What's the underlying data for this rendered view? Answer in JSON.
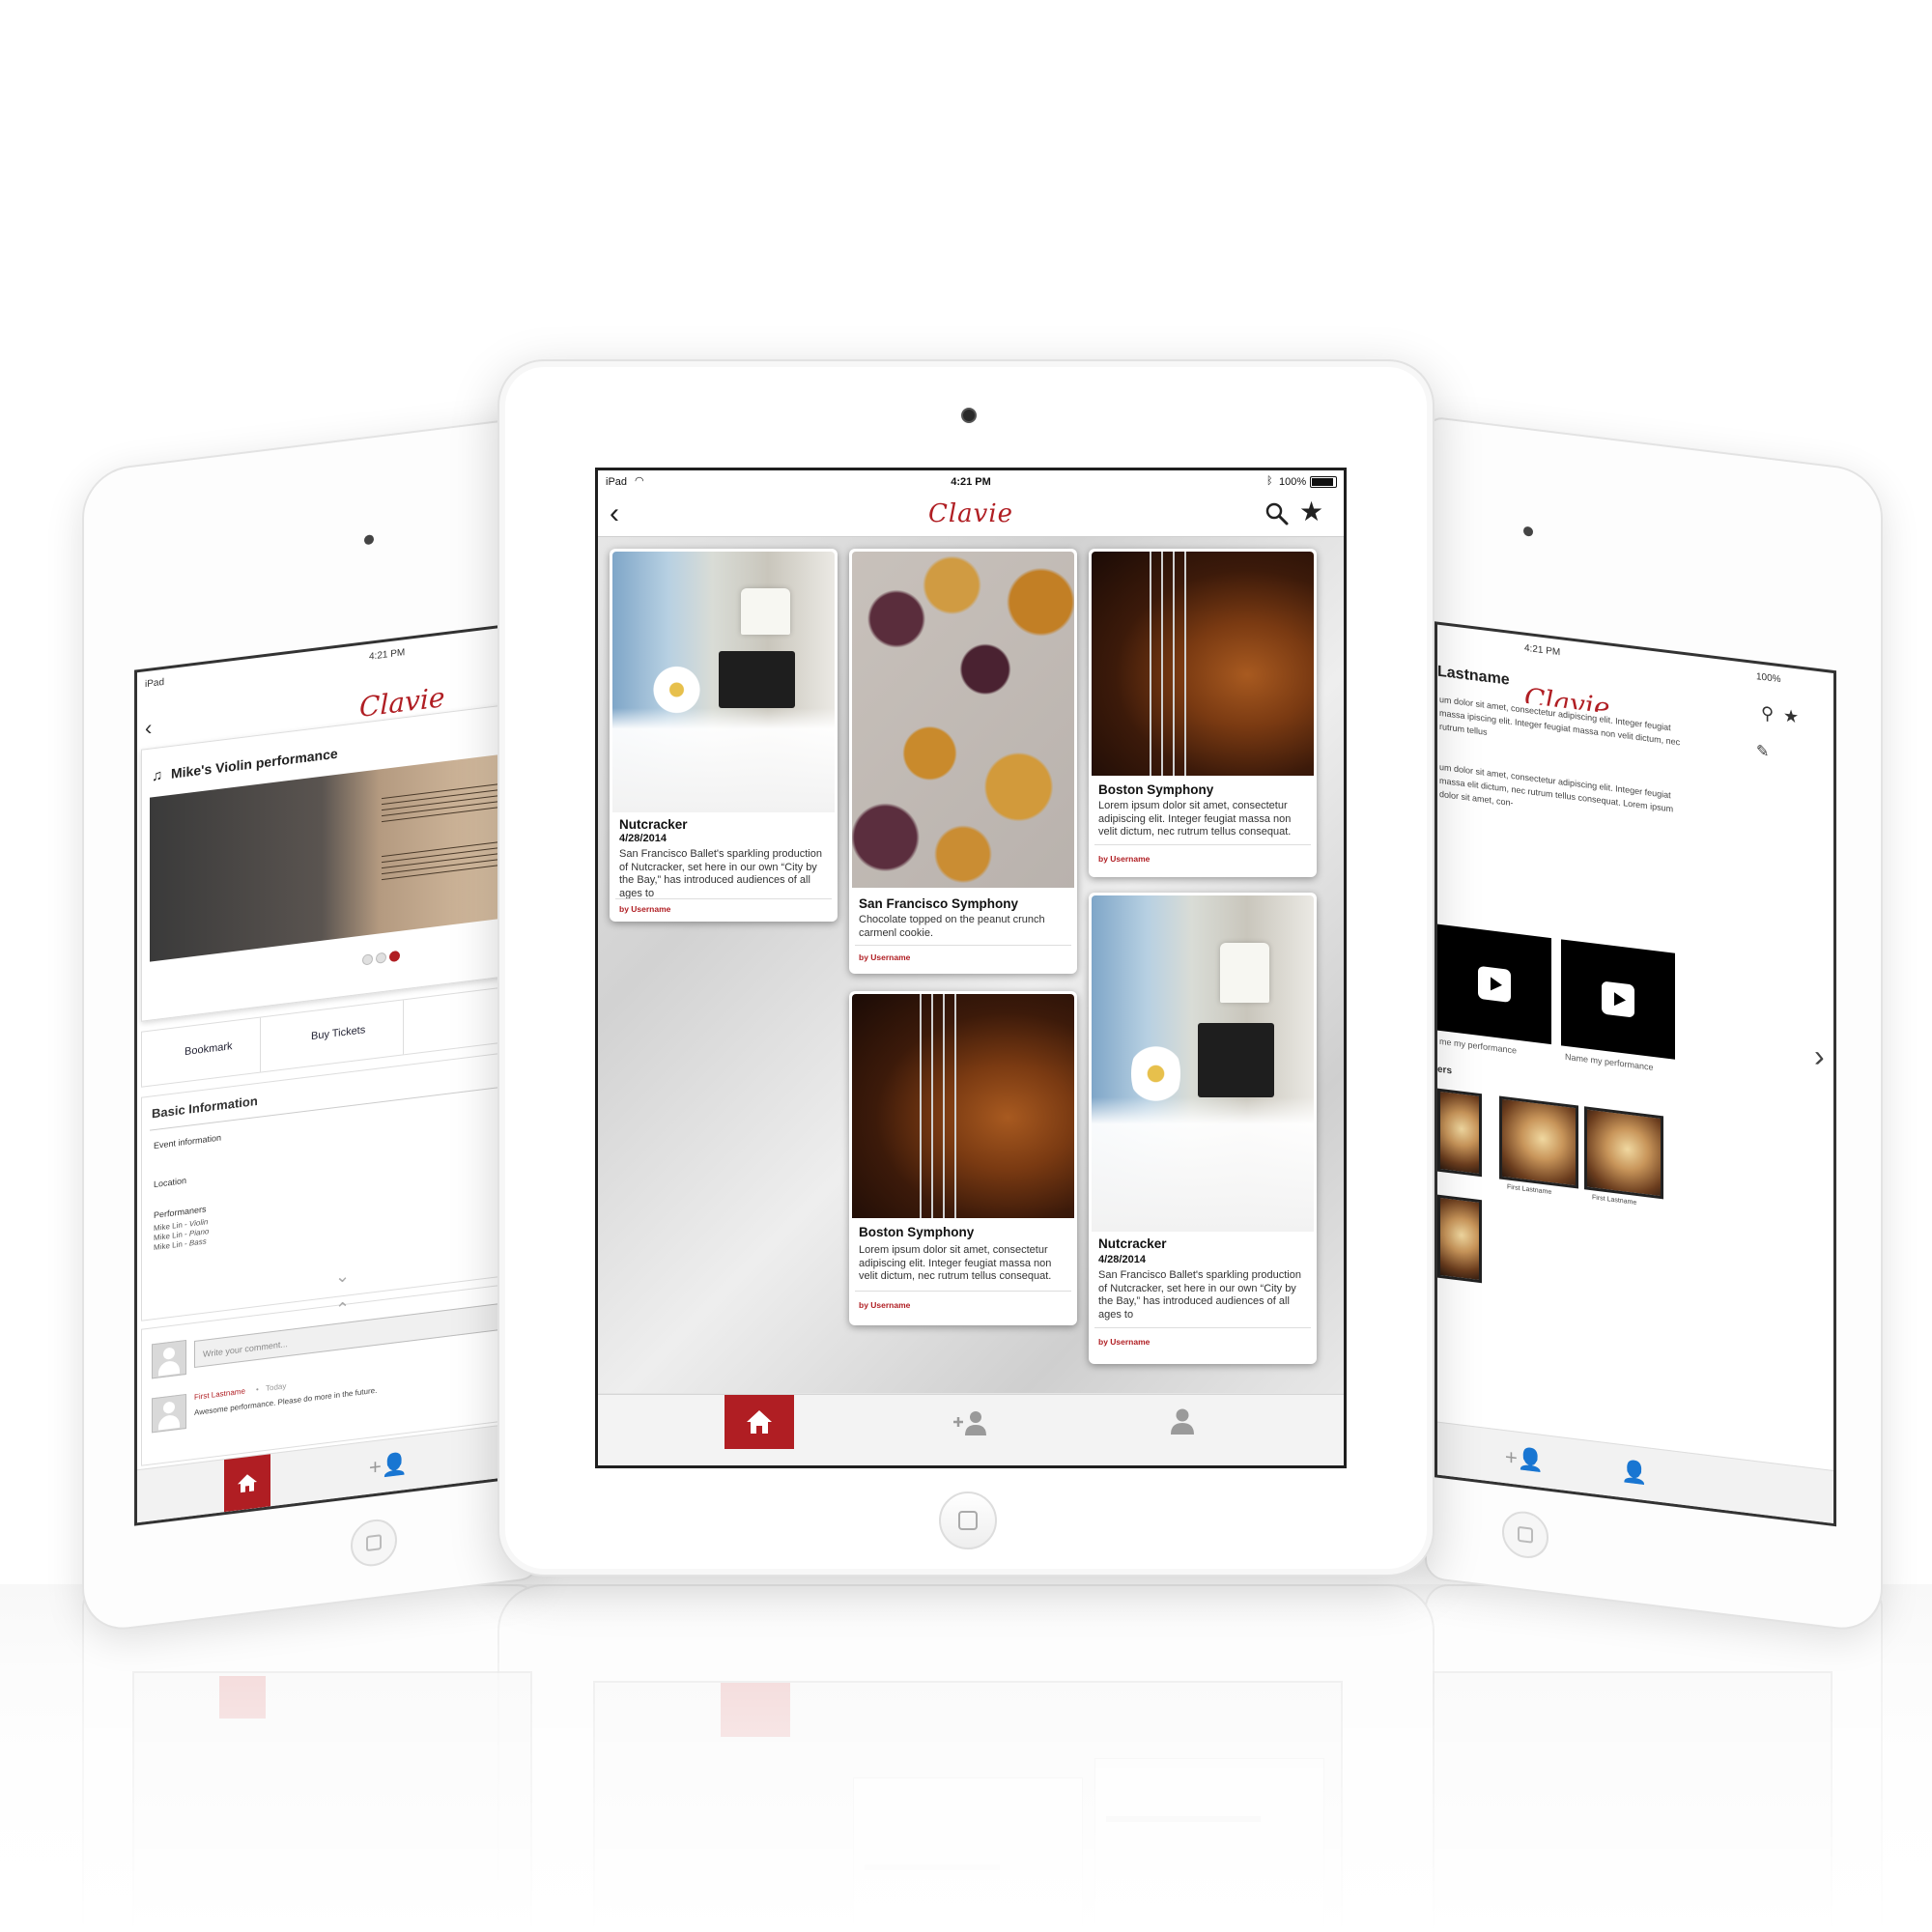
{
  "brand": {
    "name": "Clavie",
    "accent_color": "#b01e23"
  },
  "status_bar": {
    "carrier": "iPad",
    "time": "4:21 PM",
    "battery": "100%"
  },
  "nav": {
    "back_icon": "back-chevron-icon",
    "search_icon": "search-icon",
    "favorite_icon": "star-icon"
  },
  "feed": {
    "cards": [
      {
        "title": "Nutcracker",
        "date": "4/28/2014",
        "desc": "San Francisco Ballet's sparkling production of Nutcracker, set here in our own “City by the Bay,” has introduced audiences of all ages to",
        "author": "by Username"
      },
      {
        "title": "San Francisco Symphony",
        "desc": "Chocolate topped on the peanut crunch carmenl cookie.",
        "author": "by Username"
      },
      {
        "title": "Boston Symphony",
        "desc": "Lorem ipsum dolor sit amet, consectetur adipiscing elit. Integer feugiat massa non velit dictum, nec rutrum tellus consequat.",
        "author": "by Username"
      },
      {
        "title": "Boston Symphony",
        "desc": "Lorem ipsum dolor sit amet, consectetur adipiscing elit. Integer feugiat massa non velit dictum, nec rutrum tellus consequat.",
        "author": "by Username"
      },
      {
        "title": "Nutcracker",
        "date": "4/28/2014",
        "desc": "San Francisco Ballet's sparkling production of Nutcracker, set here in our own “City by the Bay,” has introduced audiences of all ages to",
        "author": "by Username"
      }
    ]
  },
  "tabs": {
    "home_icon": "home-icon",
    "add_friend_icon": "add-friend-icon",
    "profile_icon": "profile-icon"
  },
  "left_screen": {
    "status_carrier": "iPad",
    "time": "4:21 PM",
    "event_title": "Mike's Violin performance",
    "actions": {
      "bookmark": "Bookmark",
      "buy_tickets": "Buy Tickets"
    },
    "basic_info": {
      "heading": "Basic Information",
      "event_information": "Event information",
      "location": "Location",
      "performers_label": "Performaners",
      "performers": [
        {
          "name": "Mike Lin - ",
          "instrument": "Violin"
        },
        {
          "name": "Mike Lin - ",
          "instrument": "Piano"
        },
        {
          "name": "Mike Lin - ",
          "instrument": "Bass"
        }
      ]
    },
    "comment_placeholder": "Write your comment...",
    "comment": {
      "name": "First Lastname",
      "when": "Today",
      "text": "Awesome performance. Please do more in the future."
    }
  },
  "right_screen": {
    "time": "4:21 PM",
    "battery": "100%",
    "profile_name": "Lastname",
    "bio_1": "um dolor sit amet, consectetur adipiscing elit. Integer feugiat massa ipiscing elit. Integer feugiat massa non velit dictum, nec rutrum tellus",
    "bio_2": "um dolor sit amet, consectetur adipiscing elit. Integer feugiat massa elit dictum, nec rutrum tellus consequat. Lorem ipsum dolor sit amet, con-",
    "videos": [
      {
        "caption": "me my performance"
      },
      {
        "caption": "Name my performance"
      }
    ],
    "performers_heading": "ers",
    "performer_names": [
      "First Lastname",
      "First Lastname"
    ]
  }
}
